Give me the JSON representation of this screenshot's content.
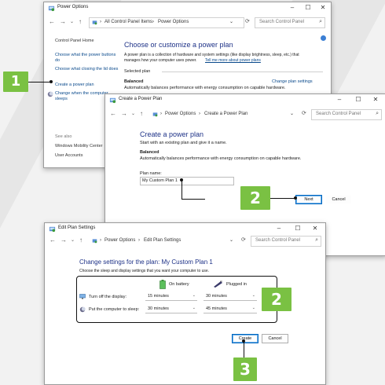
{
  "colors": {
    "callout_green": "#7ac143",
    "link_blue": "#0a4a8c",
    "heading_blue": "#1e3287",
    "accent": "#0067c0"
  },
  "window1": {
    "title": "Power Options",
    "breadcrumb": [
      "All Control Panel Items",
      "Power Options"
    ],
    "search_placeholder": "Search Control Panel",
    "sidebar": {
      "home": "Control Panel Home",
      "items": [
        "Choose what the power buttons do",
        "Choose what closing the lid does",
        "Create a power plan",
        "Change when the computer sleeps"
      ],
      "see_also": "See also",
      "see_also_items": [
        "Windows Mobility Center",
        "User Accounts"
      ]
    },
    "heading": "Choose or customize a power plan",
    "intro": "A power plan is a collection of hardware and system settings (like display brightness, sleep, etc.) that",
    "intro2": "manages how your computer uses power.",
    "intro_link": "Tell me more about power plans",
    "selected_plan": "Selected plan",
    "plan_name": "Balanced",
    "plan_link": "Change plan settings",
    "plan_desc": "Automatically balances performance with energy consumption on capable hardware."
  },
  "window2": {
    "title": "Create a Power Plan",
    "breadcrumb": [
      "Power Options",
      "Create a Power Plan"
    ],
    "search_placeholder": "Search Control Panel",
    "heading": "Create a power plan",
    "subtitle": "Start with an existing plan and give it a name.",
    "plan_name": "Balanced",
    "plan_desc": "Automatically balances performance with energy consumption on capable hardware.",
    "plan_name_label": "Plan name:",
    "plan_name_value": "My Custom Plan 1",
    "next": "Next",
    "cancel": "Cancel"
  },
  "window3": {
    "title": "Edit Plan Settings",
    "breadcrumb": [
      "Power Options",
      "Edit Plan Settings"
    ],
    "search_placeholder": "Search Control Panel",
    "heading": "Change settings for the plan: My Custom Plan 1",
    "subtitle": "Choose the sleep and display settings that you want your computer to use.",
    "col_battery": "On battery",
    "col_plugged": "Plugged in",
    "rows": [
      {
        "label": "Turn off the display:",
        "battery": "15 minutes",
        "plugged": "30 minutes",
        "icon": "monitor-icon"
      },
      {
        "label": "Put the computer to sleep:",
        "battery": "30 minutes",
        "plugged": "45 minutes",
        "icon": "moon-icon"
      }
    ],
    "create": "Create",
    "cancel": "Cancel"
  },
  "callouts": [
    "1",
    "2",
    "2",
    "3"
  ]
}
